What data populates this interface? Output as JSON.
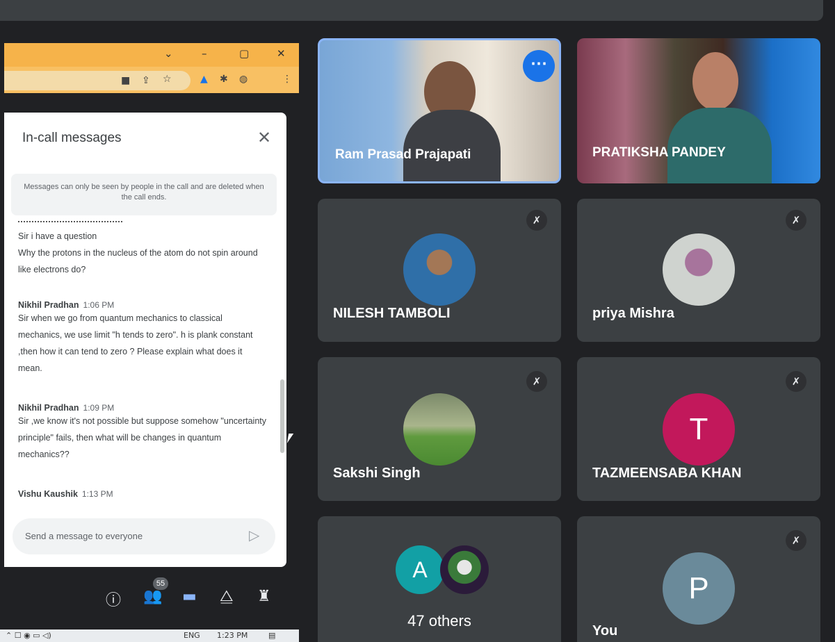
{
  "browser": {
    "window_controls": [
      "⌄",
      "–",
      "▢",
      "✕"
    ],
    "toolbar_icons": [
      "camera-icon",
      "share-icon",
      "star-icon",
      "extension-icon",
      "puzzle-icon",
      "profile-icon",
      "menu-icon"
    ]
  },
  "chat": {
    "title": "In-call messages",
    "notice": "Messages can only be seen by people in the call and are deleted when the call ends.",
    "messages": [
      {
        "sender": "",
        "time": "",
        "text": "Sir i have a question\nWhy the protons in the nucleus of the atom do not spin around like electrons do?"
      },
      {
        "sender": "Nikhil Pradhan",
        "time": "1:06 PM",
        "text": "Sir when we go from quantum mechanics to classical mechanics, we use limit \"h tends to zero\". h is plank constant ,then how it can tend to zero ? Please explain what does it mean."
      },
      {
        "sender": "Nikhil Pradhan",
        "time": "1:09 PM",
        "text": "Sir ,we know it's not possible but suppose somehow \"uncertainty principle\" fails, then what will be changes in quantum mechanics??"
      },
      {
        "sender": "Vishu Kaushik",
        "time": "1:13 PM",
        "text": ""
      }
    ],
    "input_placeholder": "Send a message to everyone"
  },
  "controls": {
    "participants_count": "55"
  },
  "participants": [
    {
      "name": "Ram Prasad Prajapati",
      "type": "video"
    },
    {
      "name": "PRATIKSHA PANDEY",
      "type": "video"
    },
    {
      "name": "NILESH TAMBOLI",
      "type": "photo"
    },
    {
      "name": "priya Mishra",
      "type": "photo"
    },
    {
      "name": "Sakshi Singh",
      "type": "photo"
    },
    {
      "name": "TAZMEENSABA KHAN",
      "type": "letter",
      "letter": "T",
      "color": "#c2185b"
    },
    {
      "name": "47 others",
      "type": "group",
      "letter": "A",
      "color": "#12a0a5"
    },
    {
      "name": "You",
      "type": "letter",
      "letter": "P",
      "color": "#6a8a9a"
    }
  ],
  "taskbar": {
    "lang": "ENG",
    "time": "1:23 PM"
  }
}
